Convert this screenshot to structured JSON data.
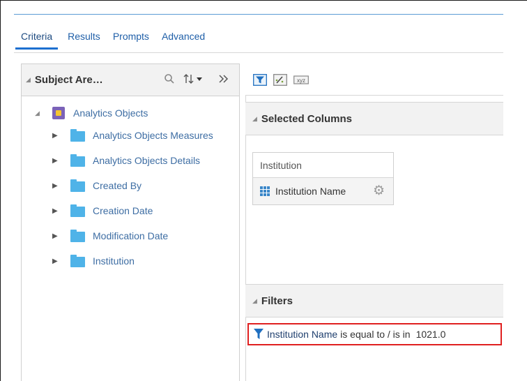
{
  "tabs": [
    {
      "label": "Criteria",
      "active": true
    },
    {
      "label": "Results",
      "active": false
    },
    {
      "label": "Prompts",
      "active": false
    },
    {
      "label": "Advanced",
      "active": false
    }
  ],
  "subject_area": {
    "title": "Subject Are…",
    "icons": [
      "search-icon",
      "sort-icon",
      "expand-panel-icon"
    ],
    "tree": {
      "root": {
        "label": "Analytics Objects",
        "icon": "subject-area-icon",
        "expanded": true
      },
      "children": [
        {
          "label": "Analytics Objects Measures",
          "icon": "folder-icon"
        },
        {
          "label": "Analytics Objects Details",
          "icon": "folder-icon"
        },
        {
          "label": "Created By",
          "icon": "folder-icon"
        },
        {
          "label": "Creation Date",
          "icon": "folder-icon"
        },
        {
          "label": "Modification Date",
          "icon": "folder-icon"
        },
        {
          "label": "Institution",
          "icon": "folder-icon"
        }
      ]
    }
  },
  "toolbar": {
    "icons": [
      "filter-icon",
      "edit-formula-icon",
      "xyz-icon"
    ],
    "xyz_label": "xyz"
  },
  "selected_columns": {
    "title": "Selected Columns",
    "column_group": "Institution",
    "column_name": "Institution Name"
  },
  "filters": {
    "title": "Filters",
    "items": [
      {
        "field": "Institution Name",
        "operator": "is equal to / is in",
        "value": "1021.0"
      }
    ]
  },
  "colors": {
    "accent": "#1d6fd0",
    "link": "#3d6da3",
    "highlight_border": "#e02020",
    "folder": "#4fb3e8"
  }
}
